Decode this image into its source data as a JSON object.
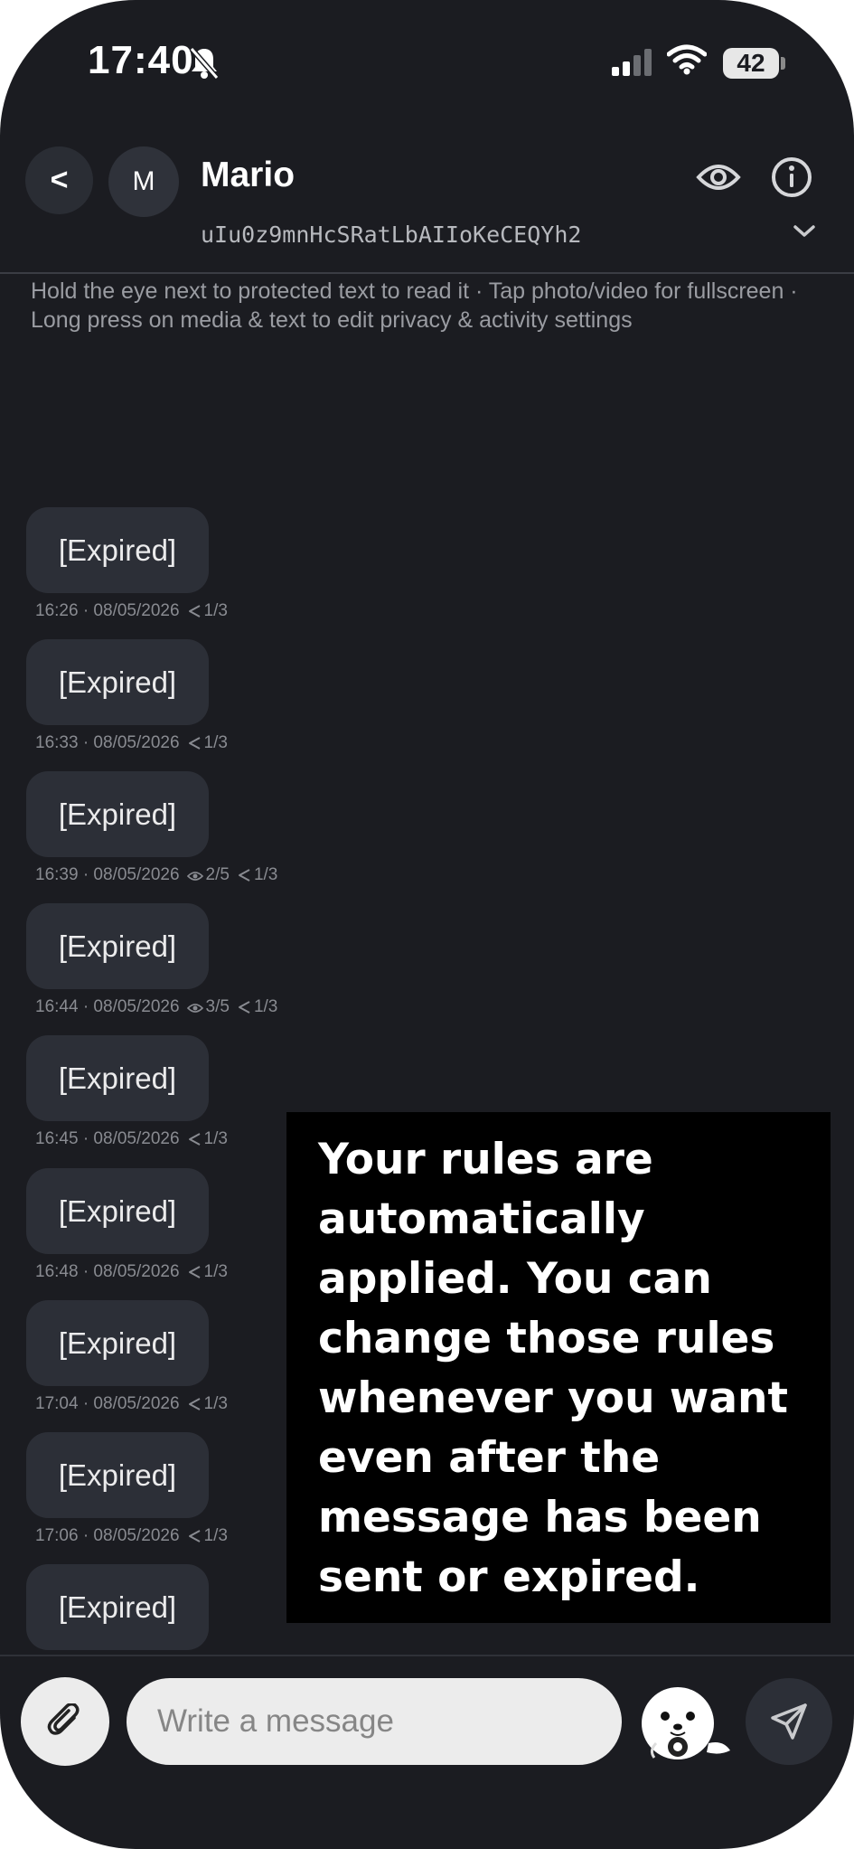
{
  "status_bar": {
    "time": "17:40",
    "battery": "42"
  },
  "header": {
    "back_label": "<",
    "avatar_initial": "M",
    "name": "Mario",
    "contact_id": "uIu0z9mnHcSRatLbAIIoKeCEQYh2"
  },
  "hint": "Hold the eye next to protected text to read it · Tap photo/video for fullscreen · Long press on media & text to edit privacy & activity settings",
  "messages": [
    {
      "text": "[Expired]",
      "time": "16:26 · 08/05/2026",
      "views": "",
      "shares": "1/3"
    },
    {
      "text": "[Expired]",
      "time": "16:33 · 08/05/2026",
      "views": "",
      "shares": "1/3"
    },
    {
      "text": "[Expired]",
      "time": "16:39 · 08/05/2026",
      "views": "2/5",
      "shares": "1/3"
    },
    {
      "text": "[Expired]",
      "time": "16:44 · 08/05/2026",
      "views": "3/5",
      "shares": "1/3"
    },
    {
      "text": "[Expired]",
      "time": "16:45 · 08/05/2026",
      "views": "",
      "shares": "1/3"
    },
    {
      "text": "[Expired]",
      "time": "16:48 · 08/05/2026",
      "views": "",
      "shares": "1/3"
    },
    {
      "text": "[Expired]",
      "time": "17:04 · 08/05/2026",
      "views": "",
      "shares": "1/3"
    },
    {
      "text": "[Expired]",
      "time": "17:06 · 08/05/2026",
      "views": "",
      "shares": "1/3"
    },
    {
      "text": "[Expired]",
      "time": "",
      "views": "",
      "shares": ""
    }
  ],
  "overlay_text": "Your rules are automatically applied. You can change those rules whenever you want even after the message has been sent or expired.",
  "composer": {
    "placeholder": "Write a message"
  },
  "icons": {
    "status": [
      "bell-slash-icon",
      "signal-icon",
      "wifi-icon",
      "battery-icon"
    ],
    "header": [
      "back-icon",
      "eye-icon",
      "info-icon",
      "chevron-down-icon"
    ],
    "composer": [
      "paperclip-icon",
      "seal-mascot-icon",
      "send-icon"
    ],
    "meta": [
      "eye-icon",
      "share-icon"
    ]
  },
  "colors": {
    "background": "#1b1c21",
    "bubble": "#2c2f37",
    "overlay": "#000000",
    "input": "#ececec"
  }
}
